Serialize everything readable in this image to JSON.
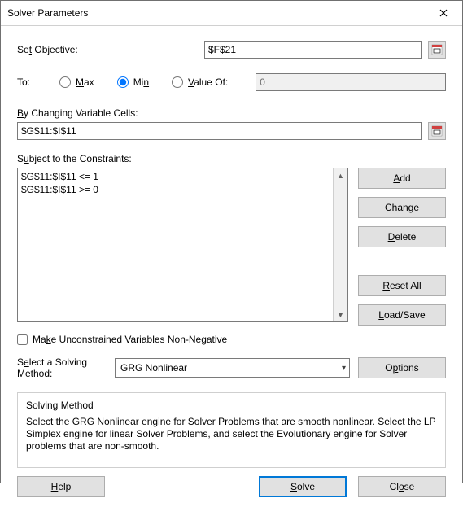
{
  "title": "Solver Parameters",
  "objective": {
    "label_pre": "Se",
    "label_u": "t",
    "label_post": " Objective:",
    "value": "$F$21"
  },
  "to": {
    "label": "To:",
    "max_u": "M",
    "max_post": "ax",
    "min_pre": "Mi",
    "min_u": "n",
    "valueof_u": "V",
    "valueof_post": "alue Of:",
    "valueof_value": "0",
    "selected": "min"
  },
  "changing": {
    "label_u": "B",
    "label_post": "y Changing Variable Cells:",
    "value": "$G$11:$I$11"
  },
  "constraints": {
    "label_pre": "S",
    "label_u": "u",
    "label_post": "bject to the Constraints:",
    "items": [
      "$G$11:$I$11 <= 1",
      "$G$11:$I$11 >= 0"
    ]
  },
  "buttons": {
    "add_u": "A",
    "add_post": "dd",
    "change_u": "C",
    "change_post": "hange",
    "delete_u": "D",
    "delete_post": "elete",
    "reset_u": "R",
    "reset_post": "eset All",
    "load_u": "L",
    "load_post": "oad/Save",
    "options_pre": "O",
    "options_u": "p",
    "options_post": "tions",
    "help_u": "H",
    "help_post": "elp",
    "solve_u": "S",
    "solve_post": "olve",
    "close_pre": "Cl",
    "close_u": "o",
    "close_post": "se"
  },
  "checkbox": {
    "label_pre": "Ma",
    "label_u": "k",
    "label_post": "e Unconstrained Variables Non-Negative",
    "checked": false
  },
  "method": {
    "label_pre": "S",
    "label_u": "e",
    "label_post": "lect a Solving Method:",
    "selected": "GRG Nonlinear"
  },
  "info": {
    "title": "Solving Method",
    "text": "Select the GRG Nonlinear engine for Solver Problems that are smooth nonlinear. Select the LP Simplex engine for linear Solver Problems, and select the Evolutionary engine for Solver problems that are non-smooth."
  }
}
